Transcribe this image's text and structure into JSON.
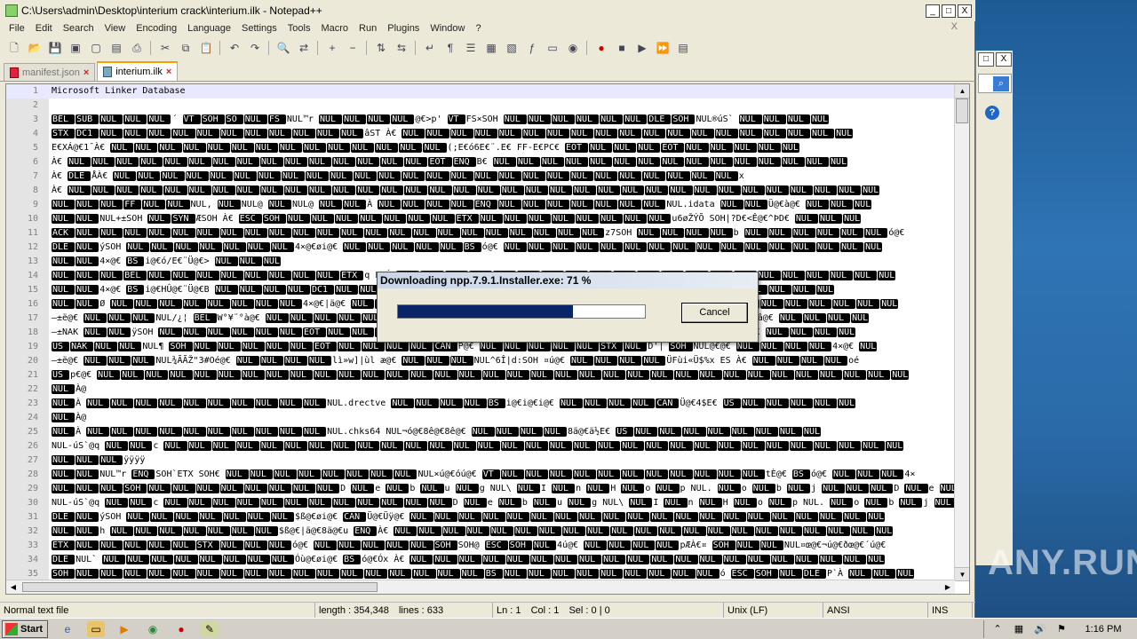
{
  "window": {
    "title": "C:\\Users\\admin\\Desktop\\interium crack\\interium.ilk - Notepad++",
    "controls": [
      "_",
      "□",
      "X"
    ]
  },
  "menu": [
    "File",
    "Edit",
    "Search",
    "View",
    "Encoding",
    "Language",
    "Settings",
    "Tools",
    "Macro",
    "Run",
    "Plugins",
    "Window",
    "?"
  ],
  "menu_close": "X",
  "toolbar_icons": [
    "new-file-icon",
    "open-file-icon",
    "save-icon",
    "save-all-icon",
    "close-icon",
    "close-all-icon",
    "print-icon",
    "cut-icon",
    "copy-icon",
    "paste-icon",
    "undo-icon",
    "redo-icon",
    "find-icon",
    "replace-icon",
    "zoom-in-icon",
    "zoom-out-icon",
    "sync-v-icon",
    "sync-h-icon",
    "wrap-icon",
    "all-chars-icon",
    "indent-guide-icon",
    "udl-icon",
    "doc-map-icon",
    "function-list-icon",
    "folder-icon",
    "monitor-icon",
    "record-icon",
    "stop-icon",
    "play-icon",
    "play-multi-icon",
    "save-macro-icon"
  ],
  "tabs": [
    {
      "label": "manifest.json",
      "active": false
    },
    {
      "label": "interium.ilk",
      "active": true
    }
  ],
  "editor_lines": [
    {
      "n": "1",
      "text": "Microsoft Linker Database"
    },
    {
      "n": "2",
      "text": ""
    },
    {
      "n": "3",
      "text": "BEL SUB NUL NUL NUL ´ VT SOH SO NUL FS NUL™r NUL NUL NUL NUL @€>p' VT FS×SOH NUL  NUL NUL NUL NUL NUL DLE SOH    NUL®úS` NUL NUL NUL NUL"
    },
    {
      "n": "4",
      "text": "STX DC1 NUL NUL NUL NUL NUL NUL NUL NUL NUL NUL NUL âST À€ NUL NUL NUL NUL NUL NUL NUL NUL NUL NUL NUL NUL NUL NUL NUL NUL NUL NUL NUL"
    },
    {
      "n": "5",
      "text": "E€XÁ@€1¯À€ NUL NUL NUL NUL NUL NUL NUL NUL NUL NUL NUL NUL NUL NUL (;E€ó6E€¨.E€ FF-E€PC€ EOT NUL NUL NUL EOT NUL NUL NUL NUL NUL"
    },
    {
      "n": "6",
      "text": "À€ NUL NUL NUL NUL NUL NUL NUL NUL NUL NUL NUL NUL NUL NUL NUL EOT ENQ B€ NUL NUL NUL NUL NUL NUL NUL NUL NUL NUL NUL NUL NUL NUL NUL"
    },
    {
      "n": "7",
      "text": "À€ DLE ÅÀ€ NUL NUL NUL NUL NUL NUL NUL NUL NUL NUL NUL NUL NUL NUL NUL NUL NUL NUL NUL NUL NUL NUL NUL NUL NUL NUL x"
    },
    {
      "n": "8",
      "text": "À€ NUL NUL NUL NUL NUL NUL NUL NUL NUL NUL NUL NUL NUL NUL NUL NUL NUL NUL NUL NUL NUL NUL NUL NUL NUL NUL NUL NUL NUL NUL NUL NUL NUL NUL"
    },
    {
      "n": "9",
      "text": "NUL NUL NUL FF NUL NUL NUL, NUL NUL@ NUL NUL@ NUL NUL À NUL NUL NUL NUL ENQ NUL NUL NUL NUL NUL NUL NUL NUL.idata NUL NUL Ü@€à@€ NUL NUL NUL"
    },
    {
      "n": "10",
      "text": "NUL NUL NUL+±SOH NUL SYN ÆSOH À€ ESC SOH NUL NUL NUL NUL NUL NUL NUL ETX NUL NUL NUL NUL NUL NUL NUL NUL u6øŽÝÕ SOH|?D€<Ê@€^ÞD€ NUL NUL NUL"
    },
    {
      "n": "11",
      "text": "ACK NUL NUL NUL NUL NUL NUL NUL NUL NUL NUL NUL NUL NUL NUL NUL NUL NUL NUL NUL NUL NUL NUL z7SOH NUL NUL NUL NUL b NUL NUL NUL NUL NUL NUL ó@€"
    },
    {
      "n": "12",
      "text": "DLE NUL ýSOH NUL NUL NUL NUL NUL NUL NUL 4×@€øi@€ NUL NUL NUL NUL NUL BS ó@€ NUL NUL NUL NUL NUL NUL NUL NUL NUL NUL NUL NUL NUL NUL NUL NUL"
    },
    {
      "n": "13",
      "text": "NUL NUL 4×@€ BS i@€ó/E€¨Ü@€> NUL NUL NUL"
    },
    {
      "n": "14",
      "text": "NUL NUL NUL BEL NUL NUL NUL NUL NUL NUL NUL NUL ETX q FSÓ NUL NUL NUL NUL NUL NUL NUL NUL NUL NUL NUL NUL NUL NUL NUL NUL NUL NUL NUL NUL NUL"
    },
    {
      "n": "15",
      "text": "NUL NUL 4×@€ BS i@€HÛ@€¨Ü@€B NUL NUL NUL NUL DC1 NUL NUL NUL NUL NUL NUL NUL NUL NUL NUL NUL NUL NUL CAN× SOH@ NUL@ ES NUL NUL NUL NUL"
    },
    {
      "n": "16",
      "text": "NUL NUL Ø NUL NUL NUL NUL NUL NUL NUL NUL 4×@€|ä@€ NUL NUL NUL NUL NUL NUL NUL NUL NUL NUL NUL NUL NUL NUL NUL NUL NUL NUL NUL NUL NUL NUL NUL"
    },
    {
      "n": "17",
      "text": "—±ë@€ NUL NUL NUL NUL/¿¦ BEL W°¥¨°à@€ NUL NUL NUL NUL NUL NUL NUL NUL NUL NUL NUL NUL NUL NUL NUL NUL NUL NUL ú-ûigál FSàâ@€ NUL NUL NUL NUL"
    },
    {
      "n": "18",
      "text": "—±NAK NUL NUL ÿSOH NUL NUL NUL NUL NUL NUL EOT NUL NUL NUL NUL NUL NUL NUL NUL NUL NUL NUL NUL NUL NUL NUL NUL NUL˝ STÀ€ NUL NUL NUL NUL"
    },
    {
      "n": "19",
      "text": "US NAK NUL NUL NUL¶ SOH NUL NUL NUL NUL NUL EOT NUL NUL NUL NUL CAN P@€ NUL NUL NUL NUL NUL STX NUL D'| SOH NUL@€@€ NUL NUL NUL NUL 4×@€ NUL"
    },
    {
      "n": "20",
      "text": "—±ë@€ NUL NUL NUL NUL¾ÃÃŽ\"3#Oé@€ NUL NUL NUL NUL lì»w]|ùl æ@€ NUL NUL NUL NUL^6Î|d:SOH ¤ú@€ NUL NUL NUL NUL ÜFùi«Ü$%x ES À€ NUL NUL NUL NUL oé"
    },
    {
      "n": "21",
      "text": "US p€@€ NUL NUL NUL NUL NUL NUL NUL NUL NUL NUL NUL NUL NUL NUL NUL NUL NUL NUL NUL NUL NUL NUL NUL NUL NUL NUL NUL NUL NUL NUL NUL NUL NUL NUL"
    },
    {
      "n": "22",
      "text": "NUL À@"
    },
    {
      "n": "23",
      "text": "NUL À NUL NUL NUL NUL NUL NUL NUL NUL NUL NUL NUL.drectve NUL NUL NUL NUL BS i@€i@€i@€ NUL NUL NUL NUL CAN Ü@€4$E€ US NUL NUL NUL NUL NUL"
    },
    {
      "n": "24",
      "text": "NUL À@"
    },
    {
      "n": "25",
      "text": "NUL À NUL NUL NUL NUL NUL NUL NUL NUL NUL NUL NUL.chks64 NUL¬ó@€8ê@€8ê@€ NUL NUL NUL NUL 8ä@€ä½E€ US NUL NUL NUL NUL NUL NUL NUL NUL"
    },
    {
      "n": "26",
      "text": "NUL-úS`@q NUL NUL c NUL NUL NUL NUL NUL NUL NUL NUL NUL NUL NUL NUL NUL NUL NUL NUL NUL NUL NUL NUL NUL NUL NUL NUL NUL NUL NUL NUL NUL NUL NUL"
    },
    {
      "n": "27",
      "text": "NUL NUL NUL ÿÿÿÿ"
    },
    {
      "n": "28",
      "text": "NUL NUL NUL™r ENQ SOH`ETX SOH€ NUL NUL NUL NUL NUL NUL NUL NUL NUL×ú@€óú@€ VT NUL NUL NUL NUL NUL NUL NUL NUL NUL NUL NUL tÈ@€ BS ó@€ NUL NUL NUL 4×"
    },
    {
      "n": "29",
      "text": "NUL NUL NUL SOH NUL NUL NUL NUL NUL NUL NUL NUL D NUL e NUL b NUL u NUL g NUL\\ NUL I NUL n NUL H NUL o NUL p NUL. NUL o NUL b NUL j NUL NUL NUL D NUL e NUL b NUL u NUL"
    },
    {
      "n": "30",
      "text": "NUL-úS`@q NUL NUL c NUL NUL NUL NUL NUL NUL NUL NUL NUL NUL NUL NUL D NUL e NUL b NUL u NUL g NUL\\ NUL I NUL n NUL H NUL o NUL p NUL. NUL o NUL b NUL j NUL NUL NUL"
    },
    {
      "n": "31",
      "text": "DLE NUL ýSOH NUL NUL NUL NUL NUL NUL NUL $ß@€øi@€ CAN Ü@€Üÿ@€ NUL NUL NUL NUL NUL NUL NUL NUL NUL NUL NUL NUL NUL NUL NUL NUL NUL NUL NUL NUL"
    },
    {
      "n": "32",
      "text": "NUL NUL h NUL NUL NUL NUL NUL NUL NUL $ß@€|ä@€8ä@€u ENQ À€ NUL NUL NUL NUL NUL NUL NUL NUL NUL NUL NUL NUL NUL NUL NUL NUL NUL NUL NUL NUL NUL"
    },
    {
      "n": "33",
      "text": "ETX NUL NUL NUL NUL NUL STX NUL NUL NUL ó@€ NUL NUL NUL NUL NUL SOH SOH@ ESC SOH NUL 4ú@€ NUL NUL NUL NUL pÆÀ€¤ SOH NUL NUL NUL¤œ@€¬ú@€ðœ@€´ú@€"
    },
    {
      "n": "34",
      "text": "DLE NUL` NUL NUL NUL NUL NUL NUL NUL NUL Óù@€øi@€ BS ó@€Óx À€ NUL NUL NUL NUL NUL NUL NUL NUL NUL NUL NUL NUL NUL NUL NUL NUL NUL NUL NUL NUL"
    },
    {
      "n": "35",
      "text": "SOH NUL NUL NUL NUL NUL NUL NUL NUL NUL NUL NUL NUL NUL NUL NUL NUL NUL BS NUL NUL NUL NUL NUL NUL NUL NUL NUL ó ESC SOH NUL  DLE P`À NUL NUL NUL"
    }
  ],
  "dialog": {
    "title": "Downloading npp.7.9.1.Installer.exe: 71 %",
    "progress": 0.71,
    "cancel_label": "Cancel"
  },
  "status": {
    "file_type": "Normal text file",
    "length": "length : 354,348",
    "lines": "lines : 633",
    "ln": "Ln : 1",
    "col": "Col : 1",
    "sel": "Sel : 0 | 0",
    "eol": "Unix (LF)",
    "encoding": "ANSI",
    "mode": "INS"
  },
  "taskbar": {
    "start_label": "Start",
    "clock": "1:16 PM"
  },
  "colors": {
    "progress_fill": "#0a246a",
    "active_tab_accent": "#f6a000"
  },
  "watermark": "ANY.RUN"
}
